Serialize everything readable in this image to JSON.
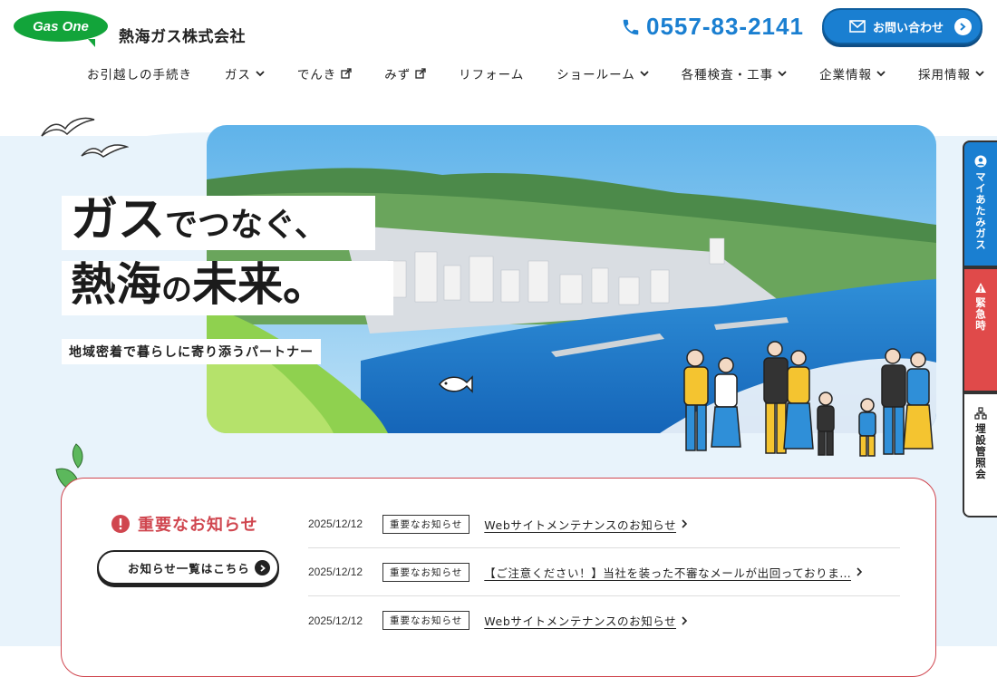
{
  "header": {
    "logo_text": "Gas One",
    "company_name": "熱海ガス株式会社",
    "phone": "0557-83-2141",
    "contact_label": "お問い合わせ"
  },
  "nav": [
    {
      "label": "お引越しの手続き",
      "icon": "none"
    },
    {
      "label": "ガス",
      "icon": "chevron-down-icon"
    },
    {
      "label": "でんき",
      "icon": "external-link-icon"
    },
    {
      "label": "みず",
      "icon": "external-link-icon"
    },
    {
      "label": "リフォーム",
      "icon": "none"
    },
    {
      "label": "ショールーム",
      "icon": "chevron-down-icon"
    },
    {
      "label": "各種検査・工事",
      "icon": "chevron-down-icon"
    },
    {
      "label": "企業情報",
      "icon": "chevron-down-icon"
    },
    {
      "label": "採用情報",
      "icon": "chevron-down-icon"
    }
  ],
  "hero": {
    "line1_big": "ガス",
    "line1_small": "でつなぐ、",
    "line2_big1": "熱海",
    "line2_small": "の",
    "line2_big2": "未来",
    "line2_end": "。",
    "subtitle": "地域密着で暮らしに寄り添うパートナー"
  },
  "side_tabs": [
    {
      "label": "マイあたみガス",
      "icon": "user-icon"
    },
    {
      "label": "緊急時",
      "icon": "warning-icon"
    },
    {
      "label": "埋設管照会",
      "icon": "pipe-icon"
    }
  ],
  "news": {
    "title": "重要なお知らせ",
    "all_button": "お知らせ一覧はこちら",
    "items": [
      {
        "date": "2025/12/12",
        "category": "重要なお知らせ",
        "text": "Webサイトメンテナンスのお知らせ"
      },
      {
        "date": "2025/12/12",
        "category": "重要なお知らせ",
        "text": "【ご注意ください！】当社を装った不審なメールが出回っておりま…"
      },
      {
        "date": "2025/12/12",
        "category": "重要なお知らせ",
        "text": "Webサイトメンテナンスのお知らせ"
      }
    ]
  },
  "colors": {
    "brand_green": "#12a43a",
    "accent_blue": "#1a7fd1",
    "alert_red": "#d0464f",
    "hero_bg": "#e8f3fb"
  }
}
